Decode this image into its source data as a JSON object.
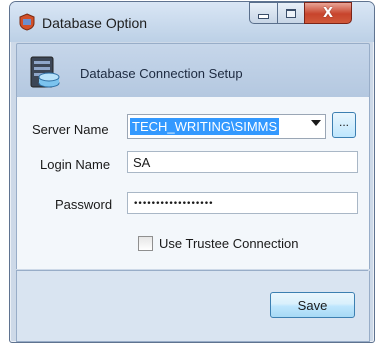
{
  "window": {
    "title": "Database Option",
    "controls": {
      "minimize": "minimize",
      "maximize": "maximize",
      "close": "X"
    }
  },
  "header": {
    "text": "Database Connection Setup"
  },
  "form": {
    "server_name_label": "Server Name",
    "server_name_value": "TECH_WRITING\\SIMMS",
    "browse_button": "...",
    "login_name_label": "Login Name",
    "login_name_value": "SA",
    "password_label": "Password",
    "password_value": "••••••••••••••••••",
    "trustee_label": "Use Trustee Connection",
    "trustee_checked": false
  },
  "footer": {
    "save_label": "Save"
  },
  "icons": {
    "app": "database-app-icon",
    "header": "database-server-icon"
  },
  "colors": {
    "selection": "#3399ff",
    "close_button": "#c7442c"
  }
}
